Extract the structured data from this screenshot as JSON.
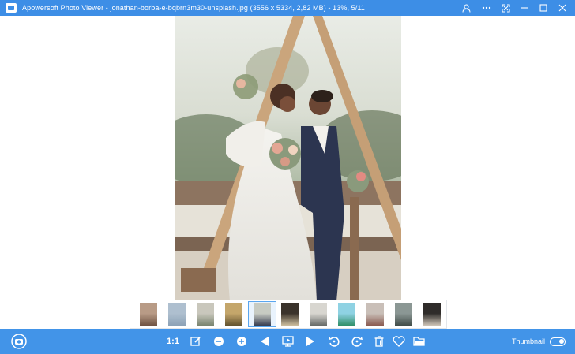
{
  "window": {
    "title": "Apowersoft Photo Viewer - jonathan-borba-e-bqbrn3m30-unsplash.jpg (3556 x 5334, 2,82 MB) - 13%, 5/11"
  },
  "title_controls": [
    {
      "name": "account-icon"
    },
    {
      "name": "more-icon"
    },
    {
      "name": "fullscreen-icon"
    },
    {
      "name": "minimize-icon"
    },
    {
      "name": "maximize-icon"
    },
    {
      "name": "close-icon"
    }
  ],
  "thumbnails": [
    {
      "color": "#b89b86",
      "accent": "#6b4f3f",
      "active": false
    },
    {
      "color": "#aebfcf",
      "accent": "#8aa0b5",
      "active": false
    },
    {
      "color": "#c9c7bc",
      "accent": "#74806b",
      "active": false
    },
    {
      "color": "#c4a66b",
      "accent": "#5d4e2b",
      "active": false
    },
    {
      "color": "#c7cbc3",
      "accent": "#2d3348",
      "active": true
    },
    {
      "color": "#3a332c",
      "accent": "#d7c7a6",
      "active": false
    },
    {
      "color": "#d8d6d0",
      "accent": "#5f6361",
      "active": false
    },
    {
      "color": "#8fd2e3",
      "accent": "#2b8b61",
      "active": false
    },
    {
      "color": "#c9bfb8",
      "accent": "#86544a",
      "active": false
    },
    {
      "color": "#8b9794",
      "accent": "#3d4844",
      "active": false
    },
    {
      "color": "#2f2c2a",
      "accent": "#d9cfc1",
      "active": false
    }
  ],
  "toolbar": {
    "ratio_label": "1:1",
    "thumbnail_label": "Thumbnail",
    "thumbnail_on": true
  },
  "colors": {
    "titlebar": "#3d8ee6",
    "toolbar": "#4294e8",
    "active_thumb_border": "#5aa6ef"
  }
}
